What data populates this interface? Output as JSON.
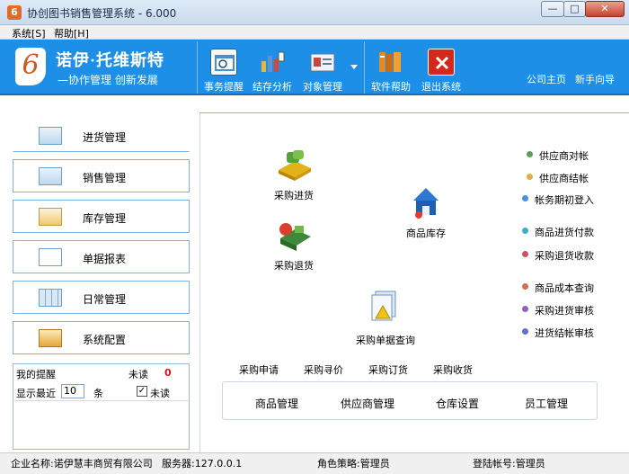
{
  "window": {
    "title": "协创图书销售管理系统 - 6.000",
    "min": "—",
    "max": "□",
    "close": "✕"
  },
  "menu": [
    "系统[S]",
    "帮助[H]"
  ],
  "brand": {
    "name": "诺伊·托维斯特",
    "slogan": "—协作管理 创新发展",
    "logo_char": "6"
  },
  "toolbar": {
    "tools": [
      {
        "label": "事务提醒",
        "icon": "calendar-icon",
        "color": "#4a8fc8"
      },
      {
        "label": "结存分析",
        "icon": "bar-chart-icon",
        "color": "#f2f2f2"
      },
      {
        "label": "对象管理",
        "icon": "id-card-icon",
        "color": "#c8d8ea"
      },
      {
        "label": "软件帮助",
        "icon": "books-icon",
        "color": "#e58a1f"
      },
      {
        "label": "退出系统",
        "icon": "exit-icon",
        "color": "#d4281c"
      }
    ],
    "links": [
      "公司主页",
      "新手向导"
    ]
  },
  "nav": [
    "进货管理",
    "销售管理",
    "库存管理",
    "单据报表",
    "日常管理",
    "系统配置"
  ],
  "reminder": {
    "title": "我的提醒",
    "unread_label": "未读",
    "unread_count": "0",
    "show_recent": "显示最近",
    "recent_count": "10",
    "unit": "条",
    "checkbox_label": "未读",
    "checked": "✓"
  },
  "flow": {
    "purchase_in": "采购进货",
    "purchase_return": "采购退货",
    "stock": "商品库存",
    "doc_query": "采购单据查询"
  },
  "side_links": [
    {
      "label": "供应商对帐",
      "color": "#5aa05a"
    },
    {
      "label": "供应商结帐",
      "color": "#e0b040"
    },
    {
      "label": "帐务期初登入",
      "color": "#4a8fe0"
    },
    {
      "label": "商品进货付款",
      "color": "#40b0c0"
    },
    {
      "label": "采购退货收款",
      "color": "#d05060"
    },
    {
      "label": "商品成本查询",
      "color": "#d07050"
    },
    {
      "label": "采购进货审核",
      "color": "#9060c0"
    },
    {
      "label": "进货结帐审核",
      "color": "#6070d0"
    }
  ],
  "process_tabs": [
    "采购申请",
    "采购寻价",
    "采购订货",
    "采购收货"
  ],
  "management": [
    "商品管理",
    "供应商管理",
    "仓库设置",
    "员工管理"
  ],
  "status": {
    "company": "企业名称:诺伊慧丰商贸有限公司",
    "server": "服务器:127.0.0.1",
    "role": "角色策略:管理员",
    "account": "登陆帐号:管理员"
  }
}
